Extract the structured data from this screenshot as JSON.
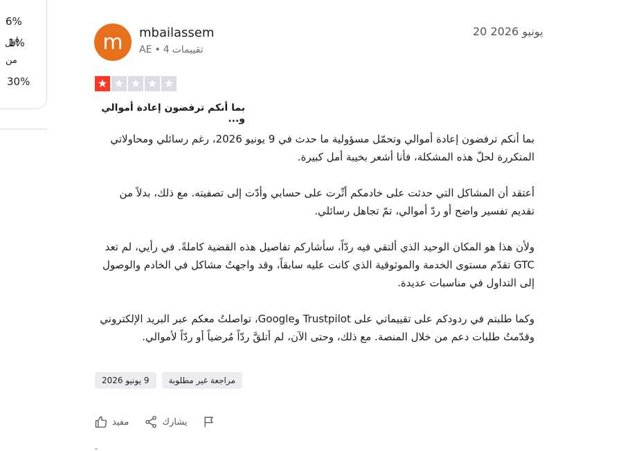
{
  "rating_panel": {
    "values": [
      "6%",
      "1%",
      "30%"
    ],
    "less_than_line1": "أقل",
    "less_than_line2": "من"
  },
  "review": {
    "avatar_letter": "m",
    "username": "mbailassem",
    "country": "AE",
    "ratings_count": "4",
    "ratings_label": "تقييمات",
    "date": "20 يونيو 2026",
    "stars_filled": 1,
    "stars_total": 5,
    "title": "بما أنكم ترفضون إعادة أموالي و...",
    "paragraphs": [
      "بما أنكم ترفضون إعادة أموالي وتحمّل مسؤولية ما حدث في 9 يونيو 2026، رغم رسائلي ومحاولاتي المتكررة لحلّ هذه المشكلة، فأنا أشعر بخيبة أمل كبيرة.",
      "أعتقد أن المشاكل التي حدثت على خادمكم أثّرت على حسابي وأدّت إلى تصفيته. مع ذلك، بدلاً من تقديم تفسير واضح أو ردّ أموالي، تمّ تجاهل رسائلي.",
      "ولأن هذا هو المكان الوحيد الذي ألتقي فيه ردّاً، سأشاركم تفاصيل هذه القضية كاملةً. في رأيي، لم تعد GTC تقدّم مستوى الخدمة والموثوقية الذي كانت عليه سابقاً، وقد واجهتُ مشاكل في الخادم والوصول إلى التداول في مناسبات عديدة.",
      "وكما طلبتم في ردودكم على تقييماتي على Trustpilot وGoogle، تواصلتُ معكم عبر البريد الإلكتروني وقدّمتُ طلبات دعم من خلال المنصة. مع ذلك، وحتى الآن، لم أتلقَّ ردّاً مُرضياً أو ردّاً لأموالي."
    ],
    "tags": [
      "9 يونيو 2026",
      "مراجعة غير مطلوبة"
    ],
    "actions": {
      "useful": "مفيد",
      "share": "يشارك"
    }
  }
}
